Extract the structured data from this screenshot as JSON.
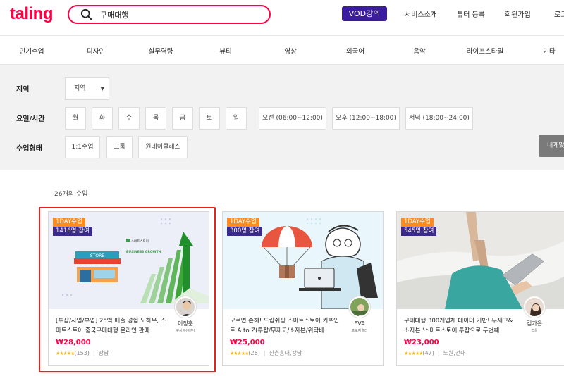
{
  "header": {
    "logo": "taling",
    "search_value": "구매대행",
    "vod_label": "VOD강의",
    "nav": [
      "서비스소개",
      "튜터 등록",
      "회원가입",
      "로그"
    ]
  },
  "categories": [
    "인기수업",
    "디자인",
    "실무역량",
    "뷰티",
    "영상",
    "외국어",
    "음악",
    "라이프스타일",
    "기타"
  ],
  "filters": {
    "region_label": "지역",
    "region_select": "지역",
    "days_label": "요일/시간",
    "days": [
      "월",
      "화",
      "수",
      "목",
      "금",
      "토",
      "일"
    ],
    "times": [
      "오전 (06:00~12:00)",
      "오후 (12:00~18:00)",
      "저녁 (18:00~24:00)"
    ],
    "type_label": "수업형태",
    "types": [
      "1:1수업",
      "그룹",
      "원데이클래스"
    ],
    "my_class_button": "내게맞"
  },
  "result_count": "26개의 수업",
  "cards": [
    {
      "tag": "1DAY수업",
      "participants": "1416명 참여",
      "title": "[투잡/사업/부업] 25억 매출 경험 노하우, 스마트스토어 중국구매대행 온라인 판매",
      "price": "₩28,000",
      "stars": "★★★★★",
      "reviews": "(153)",
      "location": "강남",
      "tutor_name": "이정훈",
      "tutor_sub": "구사부(이훈)",
      "thumb_text_store": "STORE",
      "thumb_text_smart": "스마트스토어",
      "thumb_text_growth": "BUSINESS GROWTH"
    },
    {
      "tag": "1DAY수업",
      "participants": "300명 참여",
      "title": "모르면 손해! 드랍쉬핑 스마트스토어 키포인트 A to Z(투잡/무재고/소자본/위탁배",
      "price": "₩25,000",
      "stars": "★★★★★",
      "reviews": "(26)",
      "location": "신촌홍대,강남",
      "tutor_name": "EVA",
      "tutor_sub": "프로자걸러"
    },
    {
      "tag": "1DAY수업",
      "participants": "545명 참여",
      "title": "구매대행 300개업체 데이터 기반! 무재고&소자본 '스마트스토어'투잡으로 두번째",
      "price": "₩23,000",
      "stars": "★★★★★",
      "reviews": "(47)",
      "location": "노원,건대",
      "tutor_name": "김가은",
      "tutor_sub": "겁플"
    }
  ]
}
